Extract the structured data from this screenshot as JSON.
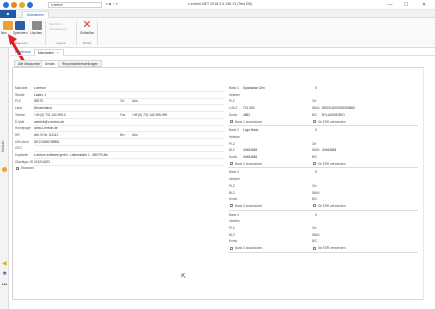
{
  "titlebar": {
    "app_field_value": "c-entron",
    "quickaccess": "▾ ◆ ✓ ▾",
    "window_title": "c-entron.NET 2018.3.0.198 13 (Test DB)",
    "minimize": "—",
    "maximize": "☐",
    "close": "✕"
  },
  "ribbon": {
    "app_menu": "■",
    "tab": "Mandanten",
    "buttons": {
      "neu": "Neu",
      "speichern": "Speichern",
      "loeschen": "Löschen",
      "schliessen": "Schließen"
    },
    "layout_items": [
      "Speichern",
      "Zurücksetzen"
    ],
    "groups": [
      "Allgemein",
      "Layout",
      "Modul"
    ]
  },
  "sidebar": {
    "label": "Module"
  },
  "doctabs": {
    "dashboard": "Dashboard",
    "mandanten": "Mandanten",
    "close": "✕"
  },
  "subtabs": [
    "Alle Mandanten",
    "Details",
    "Reportdateileinstellungen"
  ],
  "form": {
    "rows": [
      {
        "label": "Mandant",
        "value": "c-entron"
      },
      {
        "label": "Straße",
        "value": "Laster. 1"
      },
      {
        "label": "PLZ",
        "value": "89079",
        "label2": "Ort",
        "value2": "Ulm"
      },
      {
        "label": "Land",
        "value": "Deutschland"
      },
      {
        "label": "Telefon",
        "value": "+49 (0) 731 140 399-0",
        "label2": "Fax",
        "value2": "+49 (0) 731 140 399-099"
      },
      {
        "label": "E-Mail",
        "value": "vertrieb@c-entron.de"
      },
      {
        "label": "Homepage",
        "value": "www.c-entron.de"
      },
      {
        "label": "HR",
        "value": "Abt. B Nr. 111111",
        "label2": "Bei",
        "value2": "Ulm"
      },
      {
        "label": "USt-Ident.",
        "value": "DE123456789881"
      },
      {
        "label": "CEO",
        "value": ""
      },
      {
        "label": "Kopfzeile",
        "value": "c-entron software gmbh - Listerstraße 1 - 89079 Ulm"
      },
      {
        "label": "Gläubiger-ID",
        "value": "213214323"
      }
    ],
    "standard_label": "Standard",
    "standard_checked": true
  },
  "banks": [
    {
      "title": "Bank 1",
      "name": "Sparkasse Ulm",
      "number": "0",
      "inhaber": "",
      "plz": "",
      "ort": "",
      "blz": "721 500",
      "iban": "DE0912000000000883",
      "konto": "4882",
      "bic": "BYLADEM1RIO",
      "ausdrucken": true,
      "esr": false,
      "expanded": true
    },
    {
      "title": "Bank 2",
      "name": "Logo Bank",
      "number": "0",
      "inhaber": "",
      "plz": "",
      "ort": "",
      "blz": "40484848",
      "iban": "40484848",
      "konto": "40484848",
      "bic": "",
      "ausdrucken": false,
      "esr": false,
      "expanded": false
    },
    {
      "title": "Bank 3",
      "name": "",
      "number": "0",
      "inhaber": "",
      "plz": "",
      "ort": "",
      "blz": "",
      "iban": "",
      "konto": "",
      "bic": "",
      "ausdrucken": false,
      "esr": false,
      "expanded": false
    },
    {
      "title": "Bank 4",
      "name": "",
      "number": "0",
      "inhaber": "",
      "plz": "",
      "ort": "",
      "blz": "",
      "iban": "",
      "konto": "",
      "bic": "",
      "ausdrucken": false,
      "esr": false,
      "expanded": false
    }
  ],
  "bank_labels": {
    "inhaber": "Inhaber",
    "plz": "PLZ",
    "ort": "Ort",
    "blz": "BLZ",
    "iban": "IBAN",
    "konto": "Konto",
    "bic": "BIC",
    "ausdrucken": "Bank 1 ausdrucken",
    "esr": "für ESR verwenden"
  },
  "colors": {
    "accent": "#1f5aa6",
    "arrow": "#e02020"
  }
}
